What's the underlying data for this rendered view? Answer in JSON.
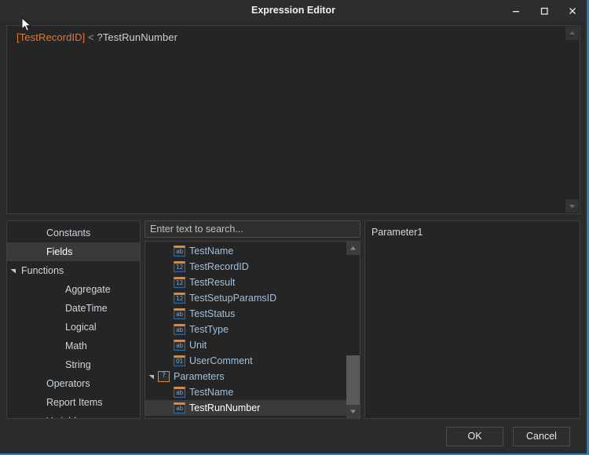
{
  "window": {
    "title": "Expression Editor",
    "controls": [
      {
        "name": "minimize",
        "glyph": "minimize-icon"
      },
      {
        "name": "maximize",
        "glyph": "maximize-icon"
      },
      {
        "name": "close",
        "glyph": "close-icon"
      }
    ],
    "accent_color": "#1d7fc4",
    "background_color": "#2b2b2b"
  },
  "editor": {
    "expression": "[TestRecordID] < ?TestRunNumber",
    "tokens": [
      {
        "text": "[TestRecordID]",
        "type": "field",
        "color": "#e8762b"
      },
      {
        "text": " < ",
        "type": "operator",
        "color": "#9b9b9b"
      },
      {
        "text": "?TestRunNumber",
        "type": "parameter",
        "color": "#cfcfcf"
      }
    ],
    "scroll_up_icon": "arrow-up-icon",
    "scroll_down_icon": "arrow-down-icon"
  },
  "categories": {
    "items": [
      {
        "label": "Constants",
        "level": 0,
        "expandable": false,
        "selected": false
      },
      {
        "label": "Fields",
        "level": 0,
        "expandable": false,
        "selected": true
      },
      {
        "label": "Functions",
        "level": 0,
        "expandable": true,
        "expanded": true,
        "selected": false
      },
      {
        "label": "Aggregate",
        "level": 1,
        "expandable": false,
        "selected": false
      },
      {
        "label": "DateTime",
        "level": 1,
        "expandable": false,
        "selected": false
      },
      {
        "label": "Logical",
        "level": 1,
        "expandable": false,
        "selected": false
      },
      {
        "label": "Math",
        "level": 1,
        "expandable": false,
        "selected": false
      },
      {
        "label": "String",
        "level": 1,
        "expandable": false,
        "selected": false
      },
      {
        "label": "Operators",
        "level": 0,
        "expandable": false,
        "selected": false
      },
      {
        "label": "Report Items",
        "level": 0,
        "expandable": false,
        "selected": false
      },
      {
        "label": "Variables",
        "level": 0,
        "expandable": false,
        "selected": false
      }
    ]
  },
  "search": {
    "value": "",
    "placeholder": "Enter text to search..."
  },
  "field_list": {
    "items": [
      {
        "label": "TestName",
        "icon": "string-field-icon",
        "icon_text": "ab",
        "indent": true,
        "selected": false,
        "group": false
      },
      {
        "label": "TestRecordID",
        "icon": "number-field-icon",
        "icon_text": "12",
        "indent": true,
        "selected": false,
        "group": false
      },
      {
        "label": "TestResult",
        "icon": "number-field-icon",
        "icon_text": "12",
        "indent": true,
        "selected": false,
        "group": false
      },
      {
        "label": "TestSetupParamsID",
        "icon": "number-field-icon",
        "icon_text": "12",
        "indent": true,
        "selected": false,
        "group": false
      },
      {
        "label": "TestStatus",
        "icon": "string-field-icon",
        "icon_text": "ab",
        "indent": true,
        "selected": false,
        "group": false
      },
      {
        "label": "TestType",
        "icon": "string-field-icon",
        "icon_text": "ab",
        "indent": true,
        "selected": false,
        "group": false
      },
      {
        "label": "Unit",
        "icon": "string-field-icon",
        "icon_text": "ab",
        "indent": true,
        "selected": false,
        "group": false
      },
      {
        "label": "UserComment",
        "icon": "binary-field-icon",
        "icon_text": "01",
        "indent": true,
        "selected": false,
        "group": false
      },
      {
        "label": "Parameters",
        "icon": "parameter-group-icon",
        "icon_text": "?",
        "indent": false,
        "selected": false,
        "group": true,
        "expanded": true
      },
      {
        "label": "TestName",
        "icon": "string-field-icon",
        "icon_text": "ab",
        "indent": true,
        "selected": false,
        "group": false
      },
      {
        "label": "TestRunNumber",
        "icon": "string-field-icon",
        "icon_text": "ab",
        "indent": true,
        "selected": true,
        "group": false
      }
    ],
    "scrollbar": {
      "up_icon": "arrow-up-icon",
      "down_icon": "arrow-down-icon"
    }
  },
  "description": {
    "text": "Parameter1"
  },
  "footer": {
    "ok_label": "OK",
    "cancel_label": "Cancel"
  }
}
